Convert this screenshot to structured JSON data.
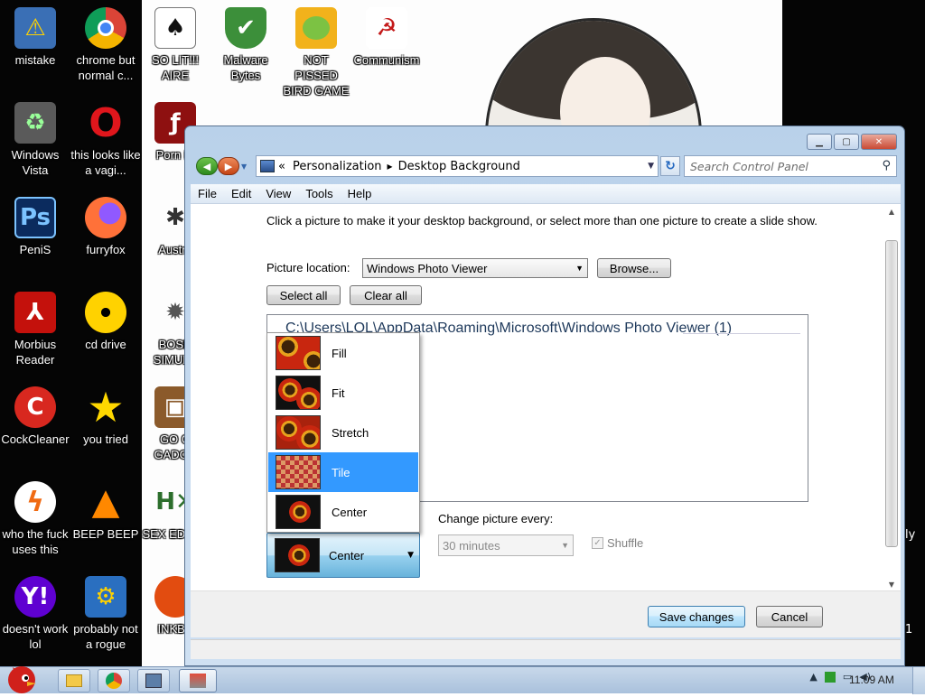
{
  "desktop": {
    "icons_left": [
      {
        "label": "mistake",
        "icon": "monitor-warning-icon"
      },
      {
        "label": "chrome but normal c...",
        "icon": "chrome-icon"
      },
      {
        "label": "Windows Vista",
        "icon": "recycle-bin-icon"
      },
      {
        "label": "this looks like a vagi...",
        "icon": "opera-icon"
      },
      {
        "label": "PeniS",
        "icon": "photoshop-icon"
      },
      {
        "label": "furryfox",
        "icon": "firefox-icon"
      },
      {
        "label": "Morbius Reader",
        "icon": "acrobat-icon"
      },
      {
        "label": "cd drive",
        "icon": "cd-icon"
      },
      {
        "label": "CockCleaner",
        "icon": "ccleaner-icon"
      },
      {
        "label": "you tried",
        "icon": "star-icon"
      },
      {
        "label": "who the fuck uses this",
        "icon": "avast-icon"
      },
      {
        "label": "BEEP BEEP",
        "icon": "vlc-icon"
      },
      {
        "label": "doesn't work lol",
        "icon": "yahoo-icon"
      },
      {
        "label": "probably not a rogue",
        "icon": "settings-gears-icon"
      }
    ],
    "icons_top": [
      {
        "label": "SO LIT!!! AIRE",
        "icon": "solitaire-icon"
      },
      {
        "label": "Malware Bytes",
        "icon": "shield-check-icon"
      },
      {
        "label": "NOT PISSED BIRD GAME",
        "icon": "pig-icon"
      },
      {
        "label": "Communism",
        "icon": "flag-icon"
      }
    ],
    "icons_partial": [
      {
        "label": "Porn Pl",
        "icon": "flash-icon"
      },
      {
        "label": "Austra",
        "icon": "spider-icon"
      },
      {
        "label": "BOSN SIMULA",
        "icon": "gear-icon"
      },
      {
        "label": "GO G GADGE",
        "icon": "briefcase-icon"
      },
      {
        "label": "SEX EDITIO",
        "icon": "hx-icon"
      },
      {
        "label": "INKBA",
        "icon": "pin-icon"
      }
    ],
    "right_edge_text": [
      "ly",
      "1"
    ]
  },
  "window": {
    "address": {
      "prefix": "«",
      "crumbs": [
        "Personalization",
        "Desktop Background"
      ]
    },
    "search_placeholder": "Search Control Panel",
    "menu": [
      "File",
      "Edit",
      "View",
      "Tools",
      "Help"
    ],
    "instruction": "Click a picture to make it your desktop background, or select more than one picture to create a slide show.",
    "picture_location_label": "Picture location:",
    "picture_location_value": "Windows Photo Viewer",
    "browse_label": "Browse...",
    "select_all_label": "Select all",
    "clear_all_label": "Clear all",
    "folder_heading": "C:\\Users\\LOL\\AppData\\Roaming\\Microsoft\\Windows Photo Viewer (1)",
    "position_dropdown": {
      "options": [
        "Fill",
        "Fit",
        "Stretch",
        "Tile",
        "Center"
      ],
      "highlighted": "Tile",
      "current": "Center"
    },
    "change_picture_label": "Change picture every:",
    "interval_value": "30 minutes",
    "shuffle_label": "Shuffle",
    "save_label": "Save changes",
    "cancel_label": "Cancel"
  },
  "taskbar": {
    "clock": "11:09 AM",
    "pinned": [
      "explorer-icon",
      "chrome-icon",
      "media-icon",
      "control-panel-icon"
    ]
  },
  "colors": {
    "selection": "#3399ff",
    "window_frame": "#b9d1ea",
    "heading_blue": "#1e395b"
  }
}
